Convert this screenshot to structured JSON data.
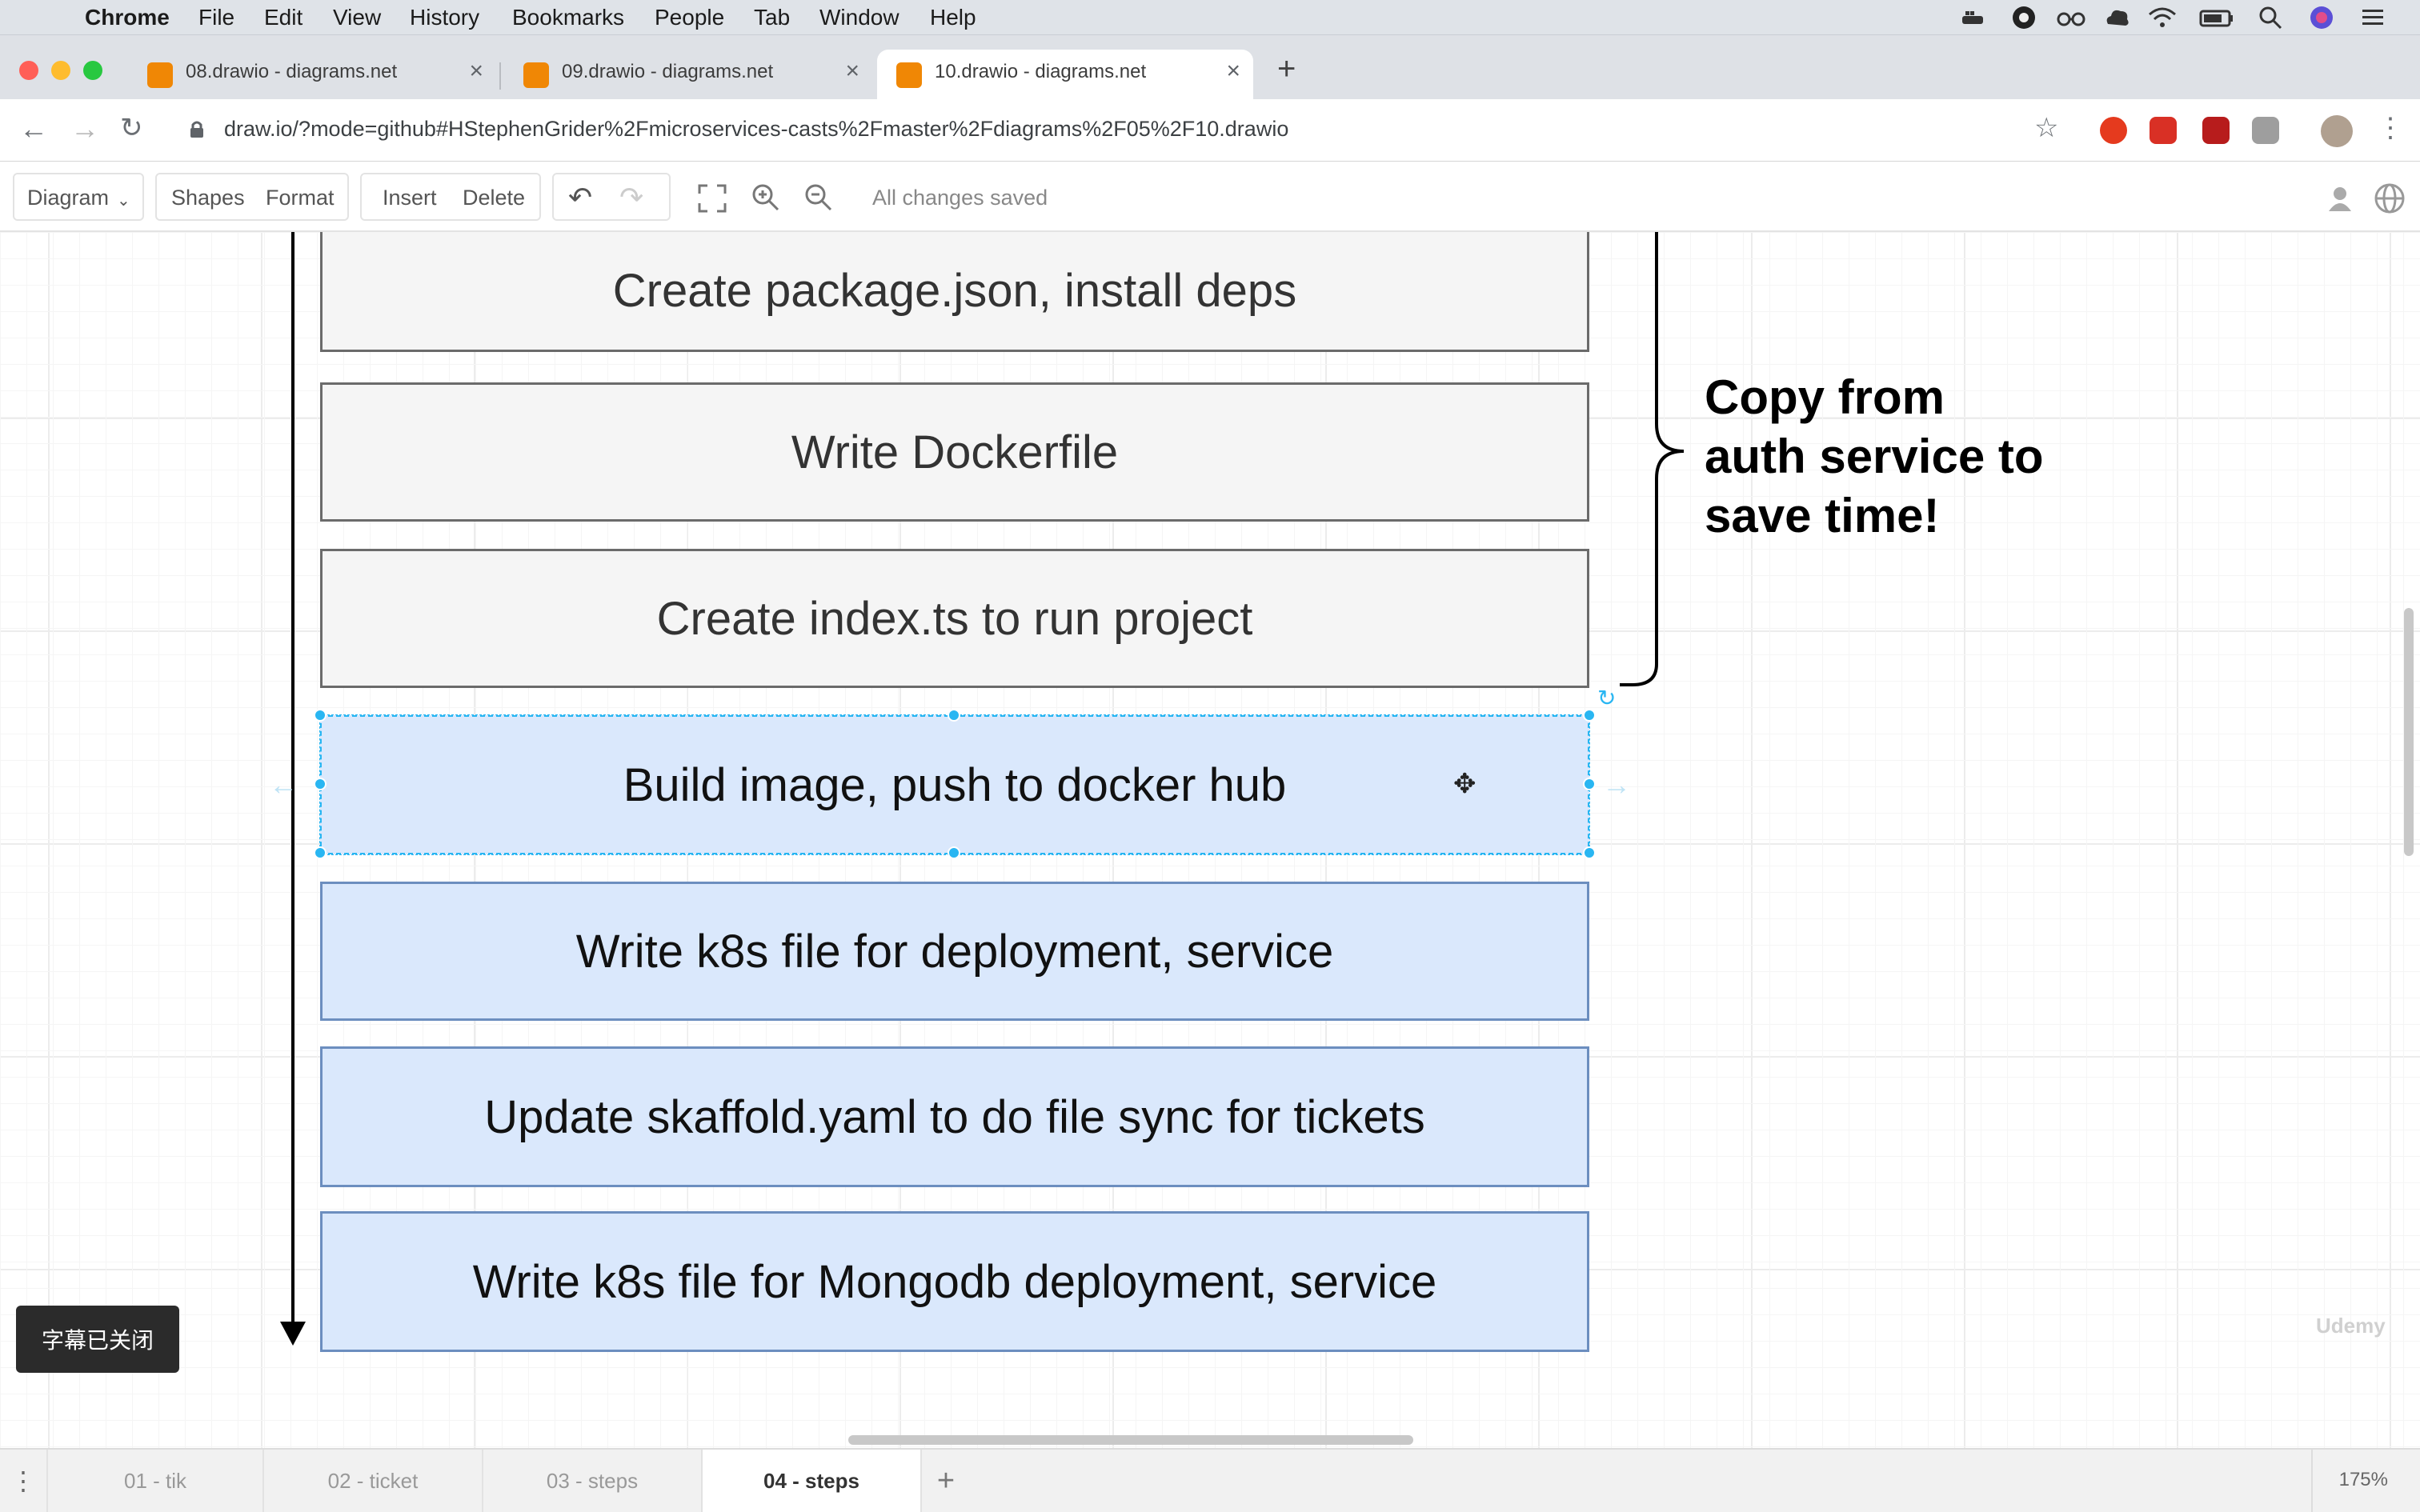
{
  "menubar": {
    "app": "Chrome",
    "items": [
      "File",
      "Edit",
      "View",
      "History",
      "Bookmarks",
      "People",
      "Tab",
      "Window",
      "Help"
    ]
  },
  "tabs": [
    {
      "title": "08.drawio - diagrams.net",
      "active": false
    },
    {
      "title": "09.drawio - diagrams.net",
      "active": false
    },
    {
      "title": "10.drawio - diagrams.net",
      "active": true
    }
  ],
  "address": {
    "url": "draw.io/?mode=github#HStephenGrider%2Fmicroservices-casts%2Fmaster%2Fdiagrams%2F05%2F10.drawio"
  },
  "toolbar": {
    "diagram_label": "Diagram",
    "shapes_label": "Shapes",
    "format_label": "Format",
    "insert_label": "Insert",
    "delete_label": "Delete",
    "status": "All changes saved"
  },
  "diagram": {
    "steps": [
      {
        "label": "Create package.json, install deps",
        "style": "grey"
      },
      {
        "label": "Write Dockerfile",
        "style": "grey"
      },
      {
        "label": "Create index.ts to run project",
        "style": "grey"
      },
      {
        "label": "Build image, push to docker hub",
        "style": "blue",
        "selected": true
      },
      {
        "label": "Write k8s file for deployment, service",
        "style": "blue"
      },
      {
        "label": "Update skaffold.yaml to do file sync for tickets",
        "style": "blue"
      },
      {
        "label": "Write k8s file for Mongodb deployment, service",
        "style": "blue"
      }
    ],
    "note": [
      "Copy from",
      "auth service to",
      "save time!"
    ]
  },
  "subtitles_badge": "字幕已关闭",
  "pages": {
    "tabs": [
      "01 - tik",
      "02 - ticket",
      "03 - steps",
      "04 - steps"
    ],
    "active": "04 - steps",
    "zoom": "175%"
  },
  "colors": {
    "grey_fill": "#f5f5f5",
    "blue_fill": "#dae8fc",
    "blue_stroke": "#6c8ebf",
    "selection": "#29b6f2"
  }
}
